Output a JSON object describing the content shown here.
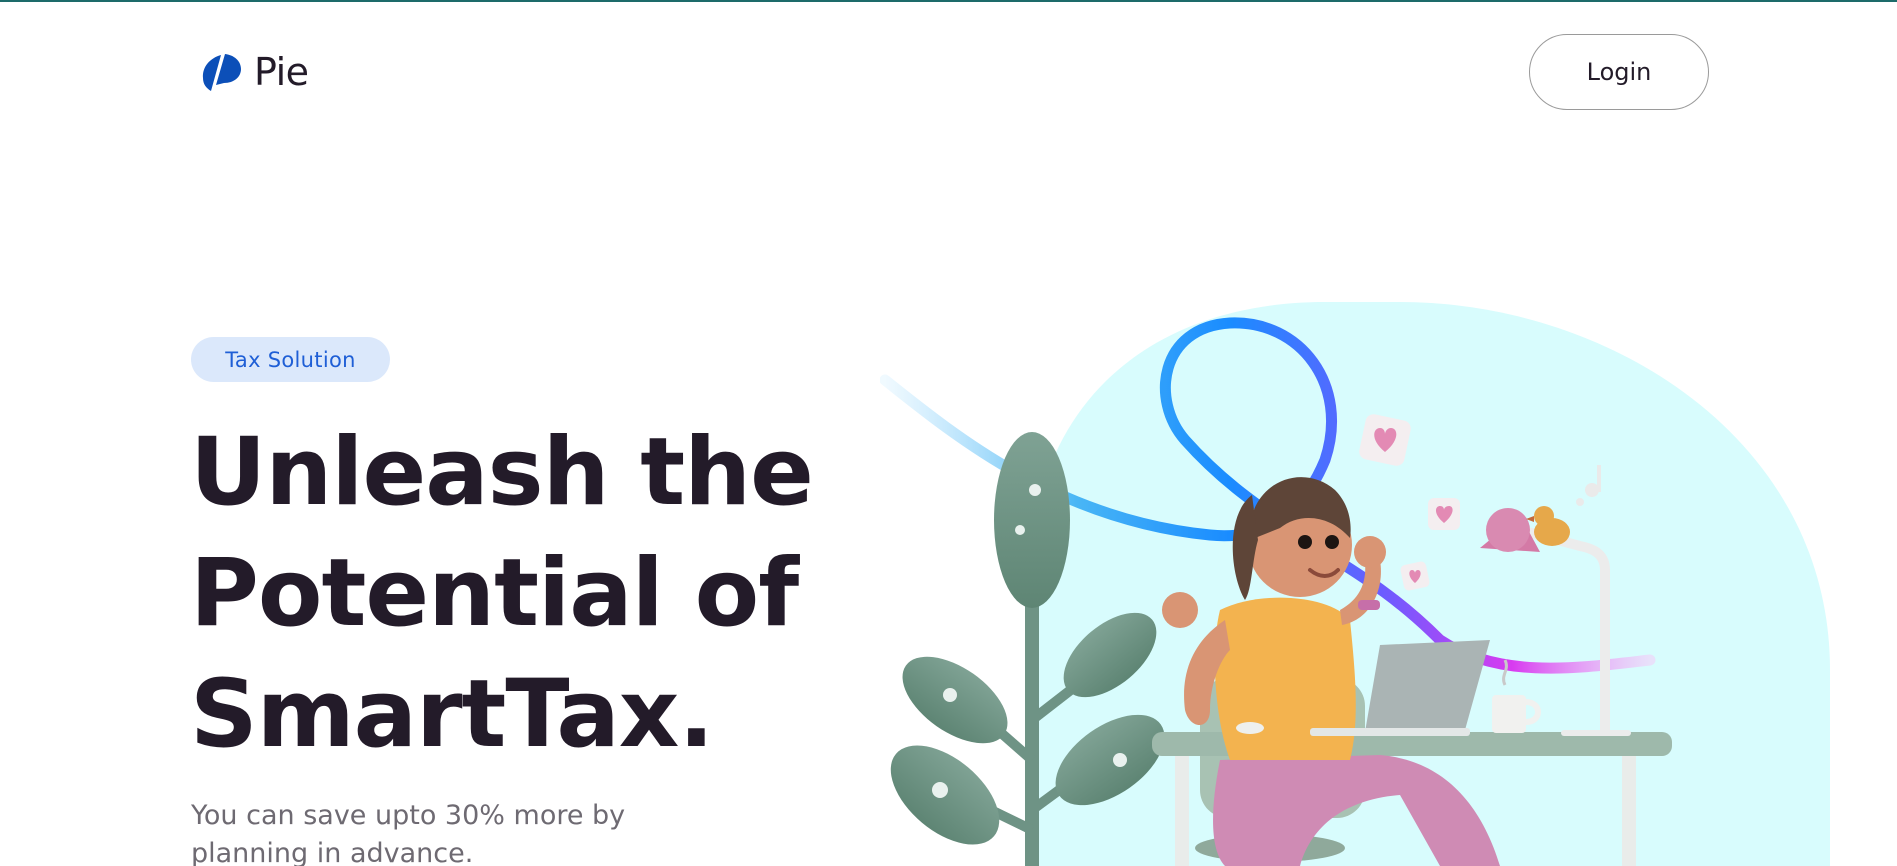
{
  "header": {
    "brand_name": "Pie",
    "brand_icon": "pie-logo-icon",
    "login_label": "Login"
  },
  "hero": {
    "badge": "Tax Solution",
    "title_lines": [
      "Unleash the",
      "Potential of",
      "SmartTax."
    ],
    "subtitle": "You can save upto 30% more by planning in advance."
  },
  "colors": {
    "top_strip": "#1d6b6a",
    "brand_blue": "#0c4fb8",
    "badge_bg": "#dbe8fb",
    "badge_text": "#1f5fd6",
    "title_text": "#231b29",
    "subtitle_text": "#6e6a72",
    "illustration_bg": "#d8fcfd"
  },
  "illustration": {
    "icon": "woman-at-desk-illustration"
  }
}
